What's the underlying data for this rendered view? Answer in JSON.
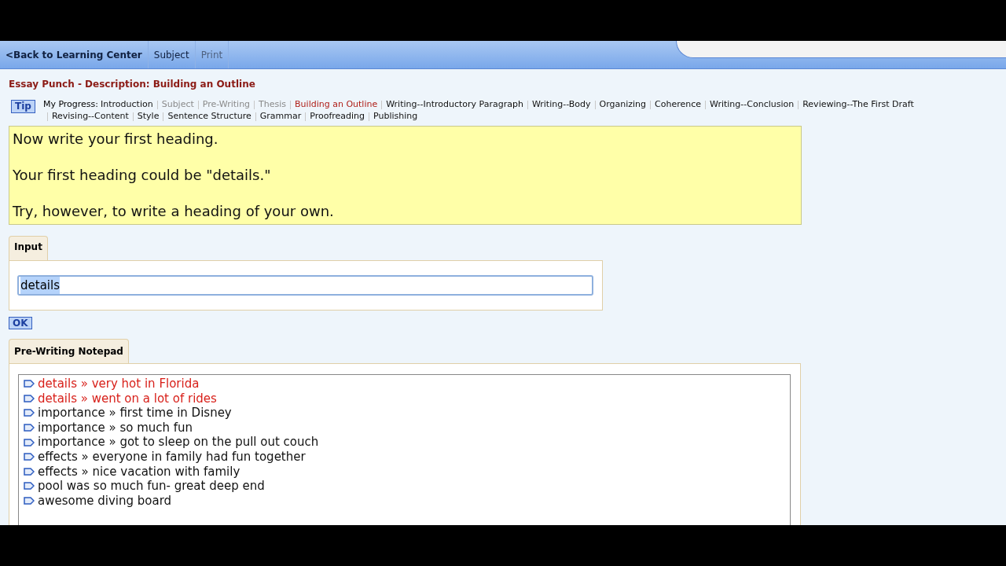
{
  "nav": [
    {
      "label": "<Back to Learning Center",
      "disabled": false,
      "bold": true
    },
    {
      "label": "Subject",
      "disabled": false,
      "bold": false
    },
    {
      "label": "Print",
      "disabled": true,
      "bold": false
    }
  ],
  "page_title": "Essay Punch - Description: Building an Outline",
  "tip": "Tip",
  "progress": {
    "label": "My Progress:",
    "steps": [
      {
        "label": "Introduction",
        "disabled": false,
        "selected": false
      },
      {
        "label": "Subject",
        "disabled": true,
        "selected": false
      },
      {
        "label": "Pre-Writing",
        "disabled": true,
        "selected": false
      },
      {
        "label": "Thesis",
        "disabled": true,
        "selected": false
      },
      {
        "label": "Building an Outline",
        "disabled": false,
        "selected": true
      },
      {
        "label": "Writing--Introductory Paragraph",
        "disabled": false,
        "selected": false
      },
      {
        "label": "Writing--Body",
        "disabled": false,
        "selected": false
      },
      {
        "label": "Organizing",
        "disabled": false,
        "selected": false
      },
      {
        "label": "Coherence",
        "disabled": false,
        "selected": false
      },
      {
        "label": "Writing--Conclusion",
        "disabled": false,
        "selected": false
      },
      {
        "label": "Reviewing--The First Draft",
        "disabled": false,
        "selected": false
      },
      {
        "label": "Revising--Content",
        "disabled": false,
        "selected": false
      },
      {
        "label": "Style",
        "disabled": false,
        "selected": false
      },
      {
        "label": "Sentence Structure",
        "disabled": false,
        "selected": false
      },
      {
        "label": "Grammar",
        "disabled": false,
        "selected": false
      },
      {
        "label": "Proofreading",
        "disabled": false,
        "selected": false
      },
      {
        "label": "Publishing",
        "disabled": false,
        "selected": false
      }
    ]
  },
  "instructions": [
    "Now write your first heading.",
    "Your first heading could be \"details.\"",
    "Try, however, to write a heading of your own."
  ],
  "input_tab": "Input",
  "input": {
    "value": "details",
    "selected": true
  },
  "ok_button": "OK",
  "notepad_tab": "Pre-Writing Notepad",
  "notepad": [
    {
      "text": "details » very hot in Florida",
      "highlighted": true
    },
    {
      "text": "details » went on a lot of rides",
      "highlighted": true
    },
    {
      "text": "importance » first time in Disney",
      "highlighted": false
    },
    {
      "text": "importance » so much fun",
      "highlighted": false
    },
    {
      "text": "importance » got to sleep on the pull out couch",
      "highlighted": false
    },
    {
      "text": "effects » everyone in family had fun together",
      "highlighted": false
    },
    {
      "text": "effects » nice vacation with family",
      "highlighted": false
    },
    {
      "text": "pool was so much fun- great deep end",
      "highlighted": false
    },
    {
      "text": "awesome diving board",
      "highlighted": false
    }
  ]
}
